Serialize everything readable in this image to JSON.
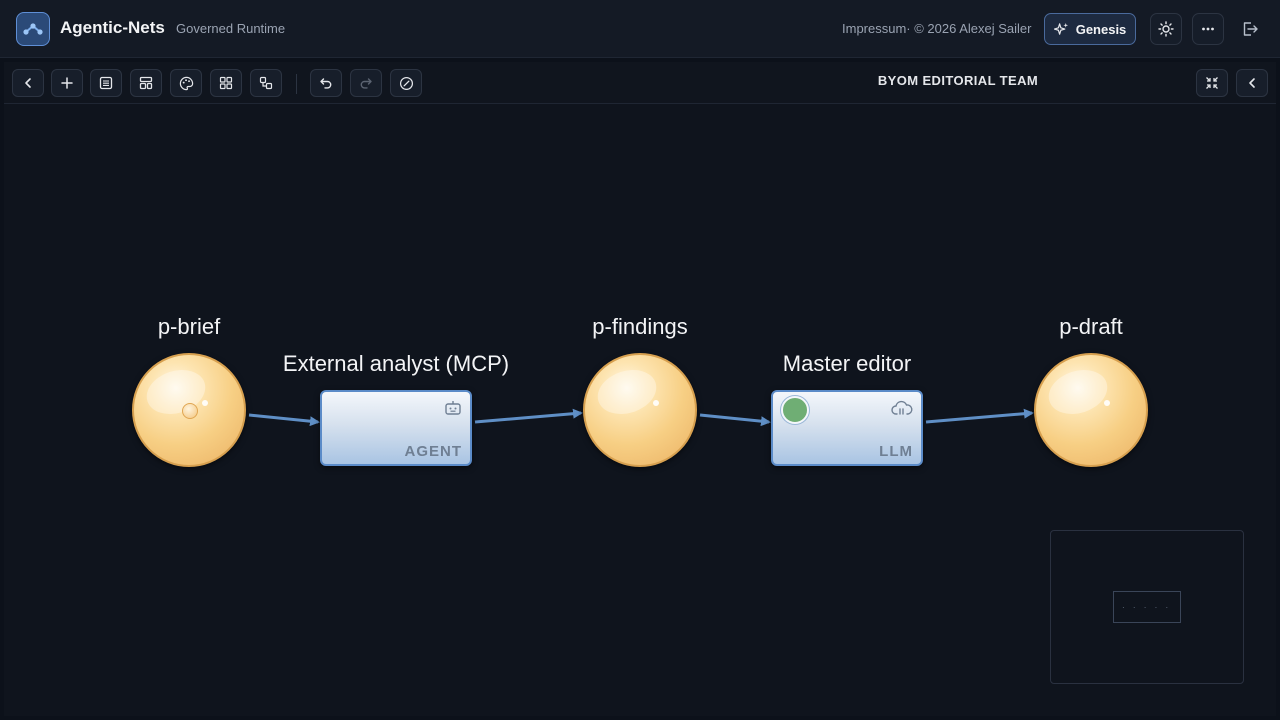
{
  "header": {
    "app_title": "Agentic-Nets",
    "app_subtitle": "Governed Runtime",
    "impressum": "Impressum· © 2026 Alexej Sailer",
    "genesis_label": "Genesis",
    "icons": [
      "app-logo-icon",
      "sparkles-icon",
      "sun-icon",
      "more-horizontal-icon",
      "logout-icon"
    ]
  },
  "toolbar": {
    "net_title": "BYOM EDITORIAL TEAM",
    "icons": [
      "chevron-left-icon",
      "plus-icon",
      "list-icon",
      "layout-icon",
      "palette-icon",
      "grid-icon",
      "nodes-icon",
      "undo-icon",
      "redo-icon",
      "compass-icon",
      "collapse-icon",
      "chevron-left-icon"
    ]
  },
  "net": {
    "places": [
      {
        "id": "p-brief",
        "label": "p-brief",
        "tokens": 1
      },
      {
        "id": "p-findings",
        "label": "p-findings",
        "tokens": 0
      },
      {
        "id": "p-draft",
        "label": "p-draft",
        "tokens": 0
      }
    ],
    "transitions": [
      {
        "id": "t-analyst",
        "label": "External analyst (MCP)",
        "kind": "AGENT",
        "icon": "robot-icon"
      },
      {
        "id": "t-editor",
        "label": "Master editor",
        "kind": "LLM",
        "icon": "cloud-brain-icon",
        "status": "active"
      }
    ],
    "arcs": [
      [
        "p-brief",
        "t-analyst"
      ],
      [
        "t-analyst",
        "p-findings"
      ],
      [
        "p-findings",
        "t-editor"
      ],
      [
        "t-editor",
        "p-draft"
      ]
    ]
  },
  "colors": {
    "background": "#0c111a",
    "place_fill": "#f7cf84",
    "place_border": "#d7a04f",
    "transition_border": "#5b8bc8",
    "arc": "#5f8fc6",
    "status_active": "#6fae74"
  }
}
